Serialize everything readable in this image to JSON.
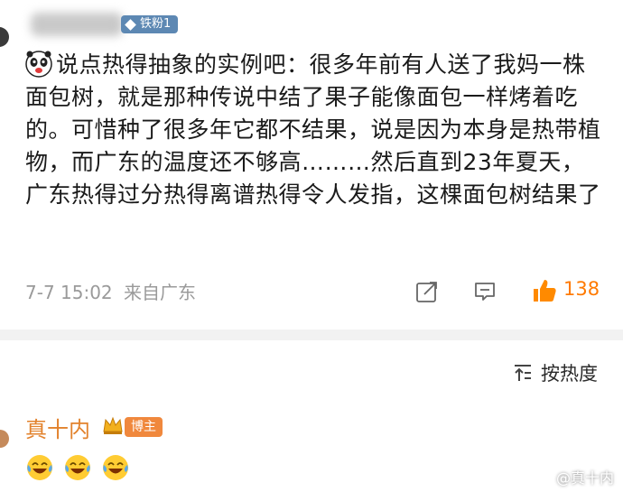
{
  "comment": {
    "badge": "铁粉1",
    "text": "说点热得抽象的实例吧：很多年前有人送了我妈一株面包树，就是那种传说中结了果子能像面包一样烤着吃的。可惜种了很多年它都不结果，说是因为本身是热带植物，而广东的温度还不够高………然后直到23年夏天，广东热得过分热得离谱热得令人发指，这棵面包树结果了",
    "timestamp": "7-7 15:02",
    "location": "来自广东",
    "like_count": "138",
    "icons": {
      "badge_icon": "diamond-icon",
      "emoji": "panda-emoji",
      "share": "share-icon",
      "comment": "comment-icon",
      "like": "thumbs-up-icon"
    }
  },
  "sort": {
    "label": "按热度",
    "icon": "sort-icon"
  },
  "reply": {
    "author": "真十内",
    "badge": "博主",
    "icon": "crown-icon",
    "emojis": [
      "laugh-cry-emoji",
      "laugh-cry-emoji",
      "laugh-cry-emoji"
    ]
  },
  "watermark": {
    "text": "@真十内",
    "icon": "weibo-logo-icon"
  },
  "colors": {
    "badge_blue": "#5d88b3",
    "author_orange": "#e2822c",
    "blogger_badge": "#f0883d",
    "like_orange": "#ff7a00",
    "meta_gray": "#9a9a9a",
    "separator": "#f2f2f2"
  }
}
